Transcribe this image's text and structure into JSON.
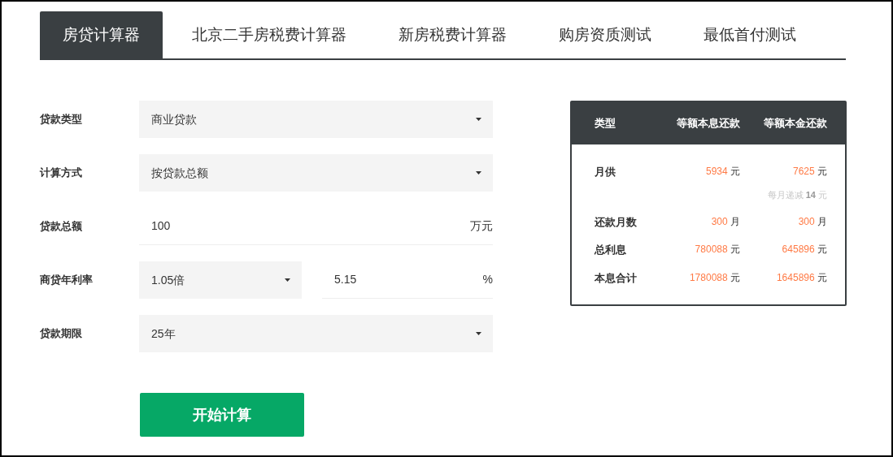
{
  "tabs": [
    {
      "label": "房贷计算器",
      "selected": true
    },
    {
      "label": "北京二手房税费计算器",
      "selected": false
    },
    {
      "label": "新房税费计算器",
      "selected": false
    },
    {
      "label": "购房资质测试",
      "selected": false
    },
    {
      "label": "最低首付测试",
      "selected": false
    }
  ],
  "form": {
    "fields": [
      {
        "kind": "select",
        "label": "贷款类型",
        "value": "商业贷款"
      },
      {
        "kind": "select",
        "label": "计算方式",
        "value": "按贷款总额"
      },
      {
        "kind": "input",
        "label": "贷款总额",
        "value": "100",
        "unit": "万元"
      },
      {
        "kind": "rate",
        "label": "商贷年利率",
        "multiplier": "1.05倍",
        "value": "5.15",
        "unit": "%"
      },
      {
        "kind": "select",
        "label": "贷款期限",
        "value": "25年"
      }
    ],
    "submit": "开始计算"
  },
  "results": {
    "columns": [
      "类型",
      "等额本息还款",
      "等额本金还款"
    ],
    "rows": [
      {
        "label": "月供",
        "values": [
          {
            "amount": "5934",
            "unit": "元"
          },
          {
            "amount": "7625",
            "unit": "元",
            "note": "每月递减 **14** 元"
          }
        ]
      },
      {
        "label": "还款月数",
        "values": [
          {
            "amount": "300",
            "unit": "月"
          },
          {
            "amount": "300",
            "unit": "月"
          }
        ]
      },
      {
        "label": "总利息",
        "values": [
          {
            "amount": "780088",
            "unit": "元"
          },
          {
            "amount": "645896",
            "unit": "元"
          }
        ]
      },
      {
        "label": "本息合计",
        "values": [
          {
            "amount": "1780088",
            "unit": "元"
          },
          {
            "amount": "1645896",
            "unit": "元"
          }
        ]
      }
    ]
  }
}
